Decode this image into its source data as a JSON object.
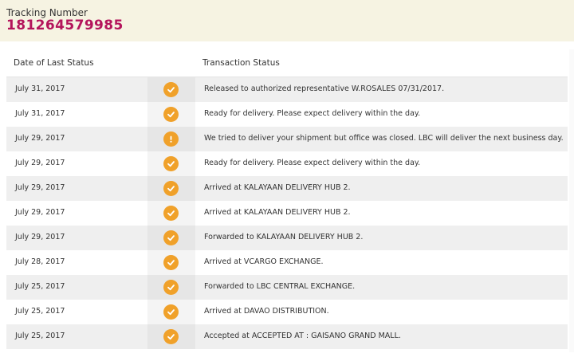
{
  "header": {
    "tracking_label": "Tracking Number",
    "tracking_number": "181264579985"
  },
  "table": {
    "col_date": "Date of Last Status",
    "col_status": "Transaction Status",
    "rows": [
      {
        "date": "July 31, 2017",
        "icon": "check-circle-icon",
        "status": "Released to authorized representative W.ROSALES 07/31/2017."
      },
      {
        "date": "July 31, 2017",
        "icon": "check-circle-icon",
        "status": "Ready for delivery. Please expect delivery within the day."
      },
      {
        "date": "July 29, 2017",
        "icon": "exclamation-circle-icon",
        "status": "We tried to deliver your shipment but office was closed. LBC will deliver the next business day."
      },
      {
        "date": "July 29, 2017",
        "icon": "check-circle-icon",
        "status": "Ready for delivery. Please expect delivery within the day."
      },
      {
        "date": "July 29, 2017",
        "icon": "check-circle-icon",
        "status": "Arrived at KALAYAAN DELIVERY HUB 2."
      },
      {
        "date": "July 29, 2017",
        "icon": "check-circle-icon",
        "status": "Arrived at KALAYAAN DELIVERY HUB 2."
      },
      {
        "date": "July 29, 2017",
        "icon": "check-circle-icon",
        "status": "Forwarded to KALAYAAN DELIVERY HUB 2."
      },
      {
        "date": "July 28, 2017",
        "icon": "check-circle-icon",
        "status": "Arrived at VCARGO EXCHANGE."
      },
      {
        "date": "July 25, 2017",
        "icon": "check-circle-icon",
        "status": "Forwarded to LBC CENTRAL EXCHANGE."
      },
      {
        "date": "July 25, 2017",
        "icon": "check-circle-icon",
        "status": "Arrived at DAVAO DISTRIBUTION."
      },
      {
        "date": "July 25, 2017",
        "icon": "check-circle-icon",
        "status": "Accepted at ACCEPTED AT : GAISANO GRAND MALL."
      }
    ]
  },
  "colors": {
    "header_bg": "#f6f3e2",
    "tracking_number": "#b4155c",
    "status_icon": "#f0a12a"
  }
}
